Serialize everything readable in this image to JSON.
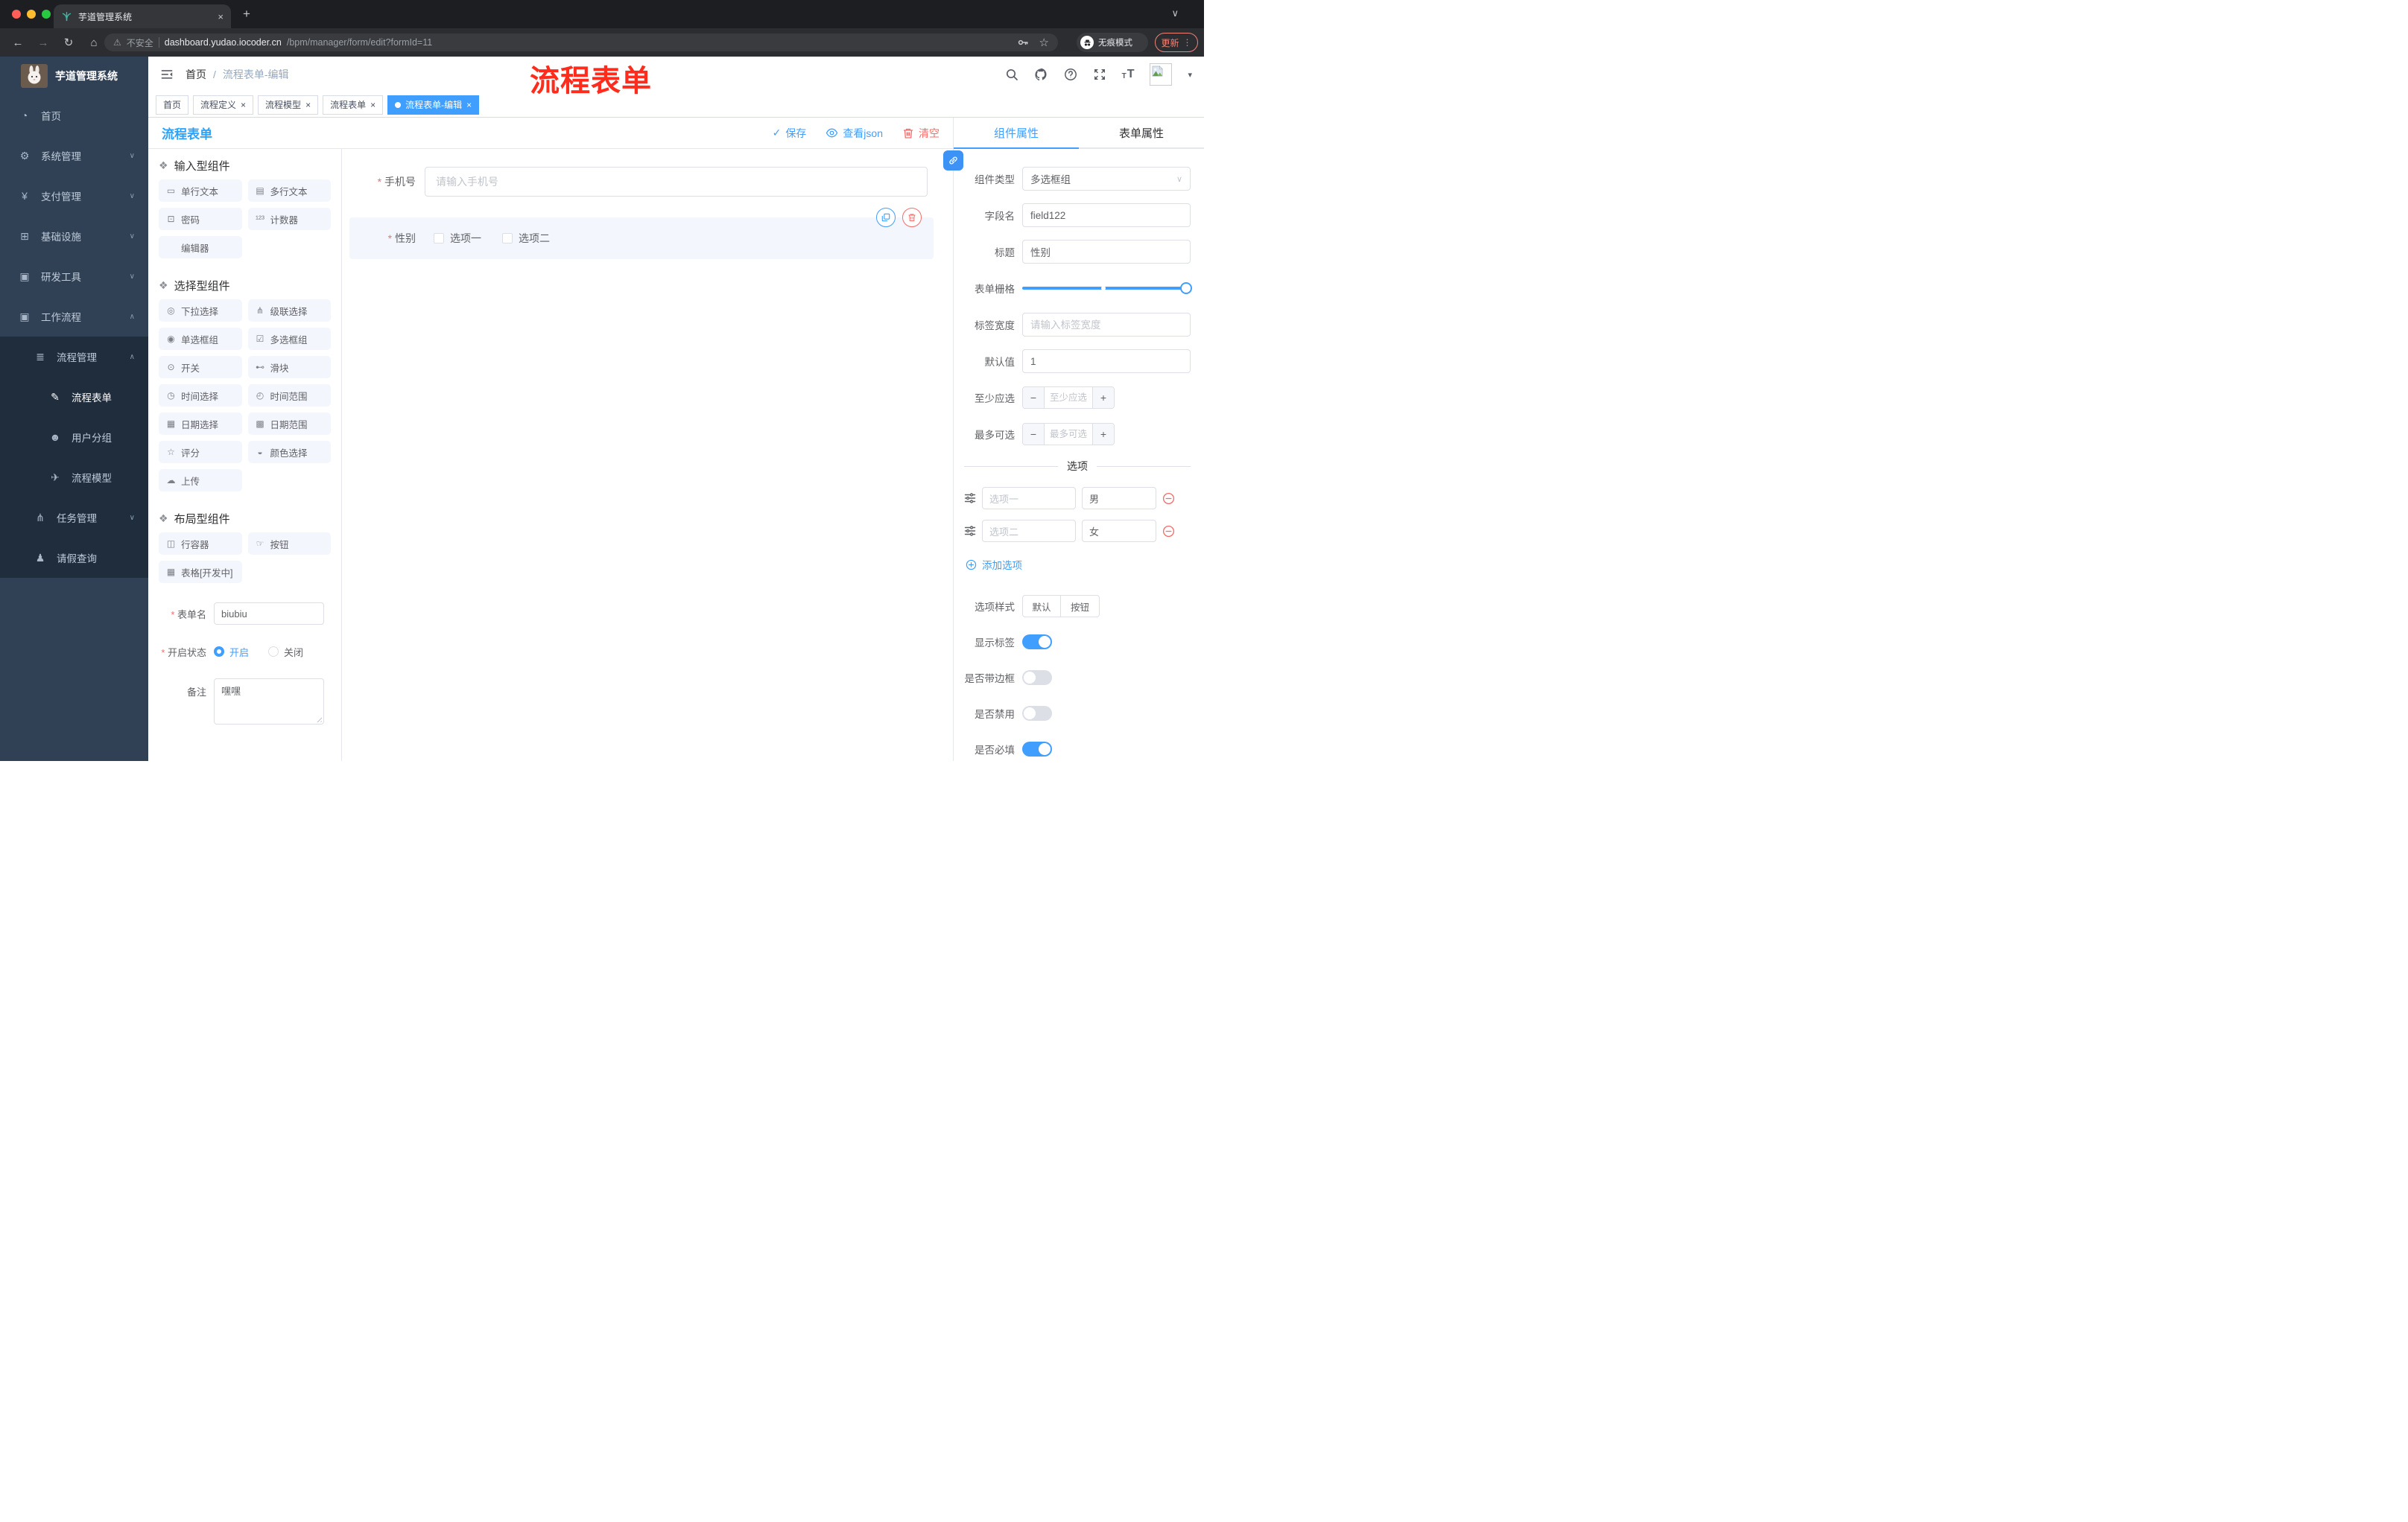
{
  "colors": {
    "primary": "#409eff",
    "danger": "#f56c6c",
    "designer_title_blue": "#2da2f8",
    "annotation_red": "#fe2c1c",
    "sidebar_bg": "#304156",
    "sidebar_submenu_bg": "#1f2d3d",
    "active_tag_bg": "#409eff",
    "update_button_red": "#ee8277"
  },
  "icons": {
    "back": "←",
    "forward": "→",
    "reload": "↻",
    "home": "⌂",
    "warning": "⚠",
    "star": "☆",
    "key": "key-svg",
    "caret_down": "▾",
    "chevron_down": "∨",
    "check": "✓",
    "dots_vertical": "⋮",
    "close": "×",
    "new_tab": "+"
  },
  "browser": {
    "tab_title": "芋道管理系统",
    "tab_close": "×",
    "new_tab": "+",
    "tab_overflow": "∨",
    "back": "←",
    "forward": "→",
    "reload": "↻",
    "home": "⌂",
    "security_warning": "⚠",
    "security_label": "不安全",
    "url_host": "dashboard.yudao.iocoder.cn",
    "url_path": "/bpm/manager/form/edit?formId=11",
    "star": "☆",
    "incognito_label": "无痕模式",
    "update_label": "更新",
    "update_menu": "⋮"
  },
  "annotation": {
    "text": "流程表单"
  },
  "sidebar": {
    "logo_title": "芋道管理系统",
    "items": [
      {
        "icon": "◔",
        "label": "首页",
        "chevron": "",
        "cls": "lvl-top"
      },
      {
        "icon": "⚙",
        "label": "系统管理",
        "chevron": "∨",
        "cls": "lvl-top"
      },
      {
        "icon": "¥",
        "label": "支付管理",
        "chevron": "∨",
        "cls": "lvl-top"
      },
      {
        "icon": "⊞",
        "label": "基础设施",
        "chevron": "∨",
        "cls": "lvl-top"
      },
      {
        "icon": "▣",
        "label": "研发工具",
        "chevron": "∨",
        "cls": "lvl-top"
      },
      {
        "icon": "▣",
        "label": "工作流程",
        "chevron": "∧",
        "cls": "lvl-top"
      },
      {
        "icon": "≣",
        "label": "流程管理",
        "chevron": "∧",
        "cls": "lvl-child dark"
      },
      {
        "icon": "✎",
        "label": "流程表单",
        "chevron": "",
        "cls": "lvl-grand dark active"
      },
      {
        "icon": "☻",
        "label": "用户分组",
        "chevron": "",
        "cls": "lvl-grand dark"
      },
      {
        "icon": "✈",
        "label": "流程模型",
        "chevron": "",
        "cls": "lvl-grand dark"
      },
      {
        "icon": "⋔",
        "label": "任务管理",
        "chevron": "∨",
        "cls": "lvl-child dark"
      },
      {
        "icon": "♟",
        "label": "请假查询",
        "chevron": "",
        "cls": "lvl-child dark"
      }
    ]
  },
  "header": {
    "breadcrumb": {
      "home": "首页",
      "sep": "/",
      "current": "流程表单-编辑"
    },
    "icon_names": [
      "search-icon",
      "github-icon",
      "question-icon",
      "fullscreen-icon",
      "font-size-icon",
      "avatar",
      "caret-down-icon"
    ],
    "avatar_caret": "▾"
  },
  "tags": [
    {
      "label": "首页",
      "close": "",
      "cls": ""
    },
    {
      "label": "流程定义",
      "close": "×",
      "cls": ""
    },
    {
      "label": "流程模型",
      "close": "×",
      "cls": ""
    },
    {
      "label": "流程表单",
      "close": "×",
      "cls": ""
    },
    {
      "label": "流程表单-编辑",
      "close": "×",
      "cls": "active"
    }
  ],
  "designer": {
    "title": "流程表单",
    "toolbar": {
      "save": "保存",
      "save_check": "✓",
      "view_json": "查看json",
      "clear": "清空"
    }
  },
  "components": {
    "section1": {
      "title": "输入型组件",
      "puzzle": "❖",
      "items": [
        {
          "icon": "▭",
          "label": "单行文本"
        },
        {
          "icon": "▤",
          "label": "多行文本"
        },
        {
          "icon": "⊡",
          "label": "密码"
        },
        {
          "icon": "¹²³",
          "label": "计数器"
        },
        {
          "icon": "",
          "label": "编辑器"
        }
      ]
    },
    "section2": {
      "title": "选择型组件",
      "puzzle": "❖",
      "items": [
        {
          "icon": "◎",
          "label": "下拉选择"
        },
        {
          "icon": "⋔",
          "label": "级联选择"
        },
        {
          "icon": "◉",
          "label": "单选框组"
        },
        {
          "icon": "☑",
          "label": "多选框组"
        },
        {
          "icon": "⊙",
          "label": "开关"
        },
        {
          "icon": "⊷",
          "label": "滑块"
        },
        {
          "icon": "◷",
          "label": "时间选择"
        },
        {
          "icon": "◴",
          "label": "时间范围"
        },
        {
          "icon": "▦",
          "label": "日期选择"
        },
        {
          "icon": "▩",
          "label": "日期范围"
        },
        {
          "icon": "☆",
          "label": "评分"
        },
        {
          "icon": "◒",
          "label": "颜色选择"
        },
        {
          "icon": "☁",
          "label": "上传"
        }
      ]
    },
    "section3": {
      "title": "布局型组件",
      "puzzle": "❖",
      "items": [
        {
          "icon": "◫",
          "label": "行容器"
        },
        {
          "icon": "☞",
          "label": "按钮"
        },
        {
          "icon": "▦",
          "label": "表格[开发中]"
        }
      ]
    }
  },
  "form_settings": {
    "name_label": "表单名",
    "name_value": "biubiu",
    "status_label": "开启状态",
    "status_options": [
      {
        "label": "开启",
        "cls": "checked"
      },
      {
        "label": "关闭",
        "cls": ""
      }
    ],
    "remark_label": "备注",
    "remark_value": "嘿嘿"
  },
  "canvas": {
    "phone": {
      "label": "手机号",
      "placeholder": "请输入手机号"
    },
    "gender": {
      "label": "性别",
      "options": [
        {
          "label": "选项一"
        },
        {
          "label": "选项二"
        }
      ]
    }
  },
  "panel": {
    "tabs": [
      {
        "label": "组件属性",
        "cls": "active"
      },
      {
        "label": "表单属性",
        "cls": ""
      }
    ],
    "component_type_label": "组件类型",
    "component_type_value": "多选框组",
    "field_name_label": "字段名",
    "field_name_value": "field122",
    "title_label": "标题",
    "title_value": "性别",
    "grid_label": "表单栅格",
    "label_width_label": "标签宽度",
    "label_width_placeholder": "请输入标签宽度",
    "default_label": "默认值",
    "default_value": "1",
    "min_label": "至少应选",
    "min_placeholder": "至少应选",
    "max_label": "最多可选",
    "max_placeholder": "最多可选",
    "stepper_minus": "−",
    "stepper_plus": "+",
    "options_title": "选项",
    "options": [
      {
        "label": "选项一",
        "value": "男"
      },
      {
        "label": "选项二",
        "value": "女"
      }
    ],
    "add_option": "添加选项",
    "option_style_label": "选项样式",
    "option_style": [
      {
        "label": "默认",
        "cls": "active"
      },
      {
        "label": "按钮",
        "cls": ""
      }
    ],
    "toggles": [
      {
        "label": "显示标签",
        "cls": "on"
      },
      {
        "label": "是否带边框",
        "cls": ""
      },
      {
        "label": "是否禁用",
        "cls": ""
      },
      {
        "label": "是否必填",
        "cls": "on"
      }
    ]
  }
}
